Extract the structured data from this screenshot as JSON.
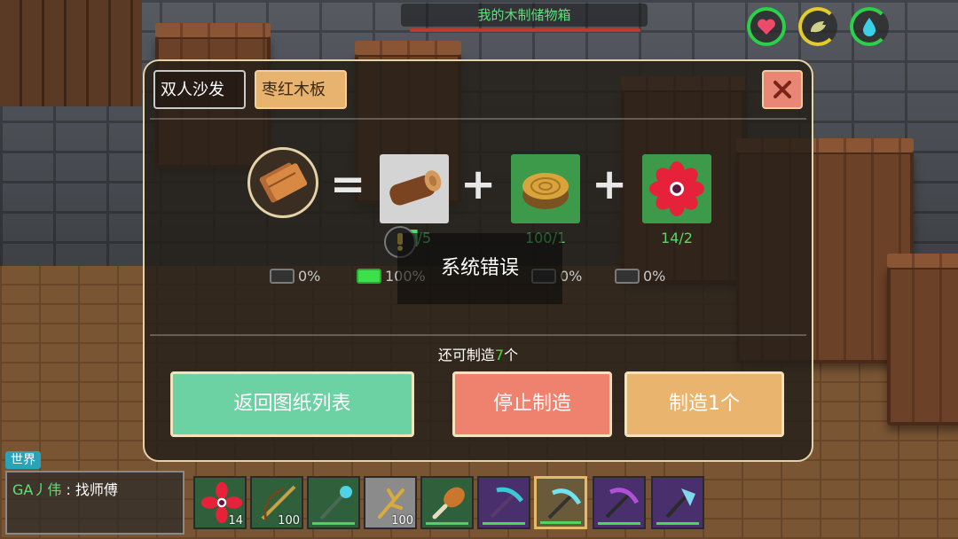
{
  "container": {
    "title": "我的木制储物箱"
  },
  "status": {
    "heart_icon": "heart-icon",
    "food_icon": "food-icon",
    "water_icon": "water-drop-icon"
  },
  "panel": {
    "tabs": [
      {
        "label": "双人沙发"
      },
      {
        "label": "枣红木板"
      }
    ],
    "close_icon": "close-icon",
    "recipe": {
      "result_icon": "wood-plank-icon",
      "ingredients": [
        {
          "icon": "log-icon",
          "count": "1█/5"
        },
        {
          "icon": "stump-icon",
          "count": "100/1"
        },
        {
          "icon": "red-flower-icon",
          "count": "14/2"
        }
      ],
      "probabilities": [
        "0%",
        "100%",
        "0%",
        "0%"
      ],
      "probability_levels": [
        0,
        1,
        0,
        0
      ]
    },
    "toast": "系统错误",
    "remaining": {
      "prefix": "还可制造",
      "value": "7",
      "suffix": "个"
    },
    "buttons": {
      "back": "返回图纸列表",
      "stop": "停止制造",
      "craft": "制造1个"
    }
  },
  "chat": {
    "channel": "世界",
    "user": "GA丿伟",
    "separator": " : ",
    "message": "找师傅"
  },
  "hotbar": [
    {
      "icon": "red-flower-icon",
      "qty": "14"
    },
    {
      "icon": "bow-icon",
      "qty": "100"
    },
    {
      "icon": "magic-staff-icon",
      "qty": ""
    },
    {
      "icon": "golden-branch-icon",
      "qty": "100"
    },
    {
      "icon": "drumstick-icon",
      "qty": ""
    },
    {
      "icon": "pickaxe-icon",
      "qty": ""
    },
    {
      "icon": "crystal-pickaxe-icon",
      "qty": ""
    },
    {
      "icon": "purple-pickaxe-icon",
      "qty": ""
    },
    {
      "icon": "crystal-axe-icon",
      "qty": ""
    }
  ]
}
